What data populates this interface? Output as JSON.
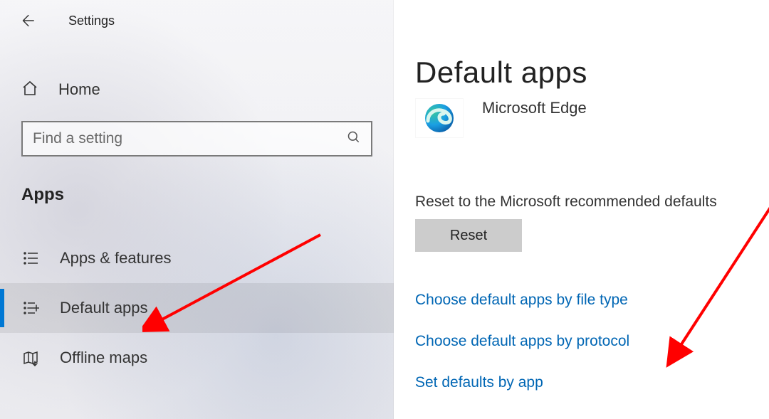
{
  "header": {
    "title": "Settings"
  },
  "home": {
    "label": "Home"
  },
  "search": {
    "placeholder": "Find a setting"
  },
  "section": {
    "title": "Apps"
  },
  "nav": {
    "items": [
      {
        "label": "Apps & features"
      },
      {
        "label": "Default apps"
      },
      {
        "label": "Offline maps"
      }
    ],
    "selected_index": 1
  },
  "page": {
    "title": "Default apps",
    "current_app": {
      "name": "Microsoft Edge",
      "icon": "edge-icon"
    },
    "reset_description": "Reset to the Microsoft recommended defaults",
    "reset_button": "Reset",
    "links": [
      "Choose default apps by file type",
      "Choose default apps by protocol",
      "Set defaults by app"
    ]
  }
}
